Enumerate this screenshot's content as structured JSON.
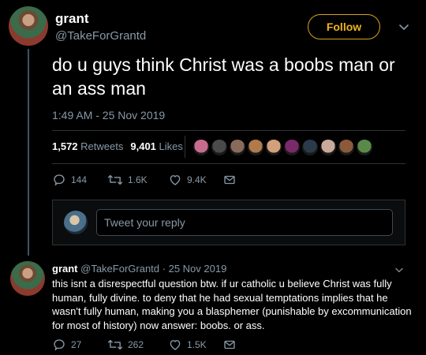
{
  "tweet": {
    "author_name": "grant",
    "author_handle": "@TakeForGrantd",
    "follow_label": "Follow",
    "text": "do u guys think Christ was a boobs man or an ass man",
    "timestamp": "1:49 AM - 25 Nov 2019",
    "retweets_count": "1,572",
    "retweets_label": "Retweets",
    "likes_count": "9,401",
    "likes_label": "Likes",
    "actions": {
      "replies": "144",
      "retweets": "1.6K",
      "likes": "9.4K"
    }
  },
  "liker_avatar_colors": [
    "#c76b8e",
    "#4a4a4a",
    "#8a6a5a",
    "#b07a4a",
    "#d2a07a",
    "#7a2a6a",
    "#2a3a4a",
    "#c9a99a",
    "#8a5a3a",
    "#5a8a4a"
  ],
  "compose": {
    "placeholder": "Tweet your reply"
  },
  "reply": {
    "author_name": "grant",
    "author_handle": "@TakeForGrantd",
    "date": "· 25 Nov 2019",
    "text": "this isnt a disrespectful question btw. if ur catholic u believe Christ was fully human, fully divine. to deny that he had sexual temptations implies that he wasn't fully human, making you a blasphemer (punishable by excommunication for most of history) now answer: boobs. or ass.",
    "actions": {
      "replies": "27",
      "retweets": "262",
      "likes": "1.5K"
    }
  },
  "colors": {
    "background": "#000000",
    "muted": "#8899a6",
    "follow_accent": "#f0b321",
    "divider": "#2f3336"
  }
}
